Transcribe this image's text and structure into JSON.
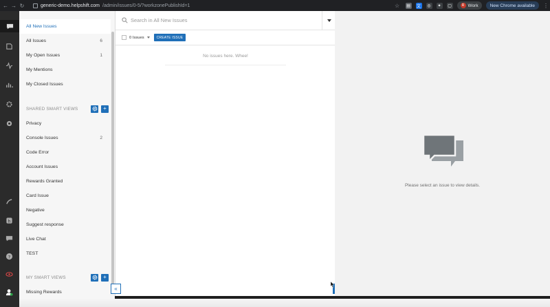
{
  "browser": {
    "url_domain": "generic-demo.helpshift.com",
    "url_path": "/admin/issues/0-5/?workzonePublishId=1",
    "profile_initial": "R",
    "profile_label": "Work",
    "update_label": "New Chrome available"
  },
  "sidebar": {
    "items_top": [
      {
        "label": "All New Issues",
        "count": "",
        "active": true
      },
      {
        "label": "All Issues",
        "count": "6"
      },
      {
        "label": "My Open Issues",
        "count": "1"
      },
      {
        "label": "My Mentions",
        "count": ""
      },
      {
        "label": "My Closed Issues",
        "count": ""
      }
    ],
    "shared_section_title": "SHARED SMART VIEWS",
    "shared_items": [
      {
        "label": "Privacy",
        "count": ""
      },
      {
        "label": "Console Issues",
        "count": "2"
      },
      {
        "label": "Code Error",
        "count": ""
      },
      {
        "label": "Account Issues",
        "count": ""
      },
      {
        "label": "Rewards Granted",
        "count": ""
      },
      {
        "label": "Card Issue",
        "count": ""
      },
      {
        "label": "Negative",
        "count": ""
      },
      {
        "label": "Suggest response",
        "count": ""
      },
      {
        "label": "Live Chat",
        "count": ""
      },
      {
        "label": "TEST",
        "count": ""
      }
    ],
    "my_section_title": "MY SMART VIEWS",
    "my_items": [
      {
        "label": "Missing Rewards",
        "count": ""
      }
    ]
  },
  "list": {
    "search_placeholder": "Search in All New Issues",
    "issues_count": "0 Issues",
    "create_label": "CREATE ISSUE",
    "empty_message": "No issues here. Whee!"
  },
  "detail": {
    "message": "Please select an issue to view details."
  },
  "colors": {
    "accent": "#1f6fb8",
    "rail": "#2b2b2b"
  }
}
